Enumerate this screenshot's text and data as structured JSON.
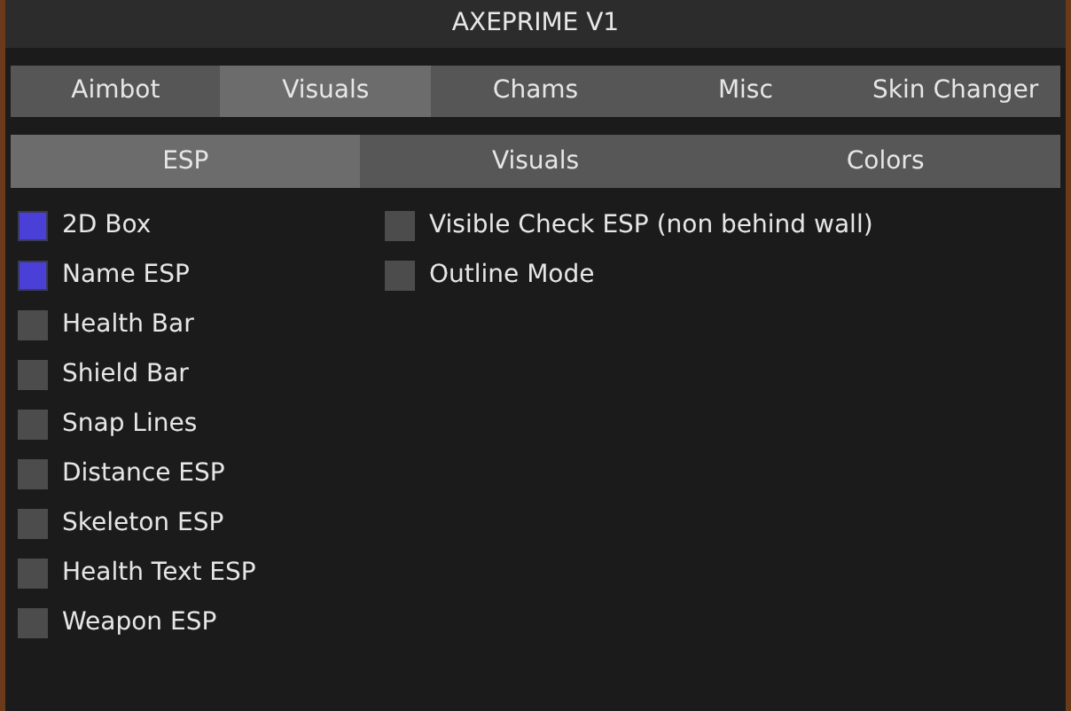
{
  "window": {
    "title": "AXEPRIME V1"
  },
  "tabs": [
    {
      "label": "Aimbot",
      "selected": false
    },
    {
      "label": "Visuals",
      "selected": true
    },
    {
      "label": "Chams",
      "selected": false
    },
    {
      "label": "Misc",
      "selected": false
    },
    {
      "label": "Skin Changer",
      "selected": false
    }
  ],
  "subtabs": [
    {
      "label": "ESP",
      "selected": true
    },
    {
      "label": "Visuals",
      "selected": false
    },
    {
      "label": "Colors",
      "selected": false
    }
  ],
  "left_options": [
    {
      "label": "2D Box",
      "checked": true
    },
    {
      "label": "Name ESP",
      "checked": true
    },
    {
      "label": "Health Bar",
      "checked": false
    },
    {
      "label": "Shield Bar",
      "checked": false
    },
    {
      "label": "Snap Lines",
      "checked": false
    },
    {
      "label": "Distance ESP",
      "checked": false
    },
    {
      "label": "Skeleton ESP",
      "checked": false
    },
    {
      "label": "Health Text ESP",
      "checked": false
    },
    {
      "label": "Weapon ESP",
      "checked": false
    }
  ],
  "right_options": [
    {
      "label": "Visible Check ESP (non behind wall)",
      "checked": false
    },
    {
      "label": "Outline Mode",
      "checked": false
    }
  ]
}
